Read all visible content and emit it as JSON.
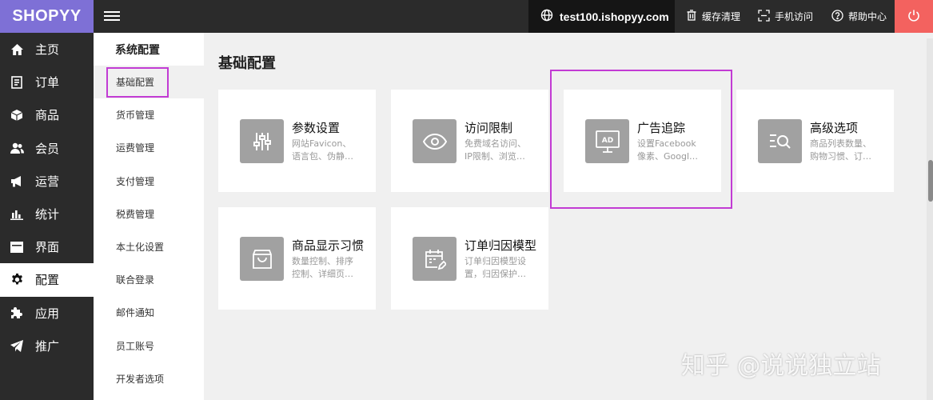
{
  "header": {
    "logo": "SHOPYY",
    "domain": "test100.ishopyy.com",
    "links": [
      {
        "label": "缓存清理",
        "icon": "trash-icon"
      },
      {
        "label": "手机访问",
        "icon": "mobile-icon"
      },
      {
        "label": "帮助中心",
        "icon": "help-icon"
      }
    ],
    "accent_color": "#7e70d6",
    "power_color": "#f3625f"
  },
  "nav": {
    "items": [
      {
        "label": "主页",
        "icon": "home-icon"
      },
      {
        "label": "订单",
        "icon": "order-icon"
      },
      {
        "label": "商品",
        "icon": "box-icon"
      },
      {
        "label": "会员",
        "icon": "users-icon"
      },
      {
        "label": "运营",
        "icon": "megaphone-icon"
      },
      {
        "label": "统计",
        "icon": "bar-chart-icon"
      },
      {
        "label": "界面",
        "icon": "layout-icon"
      },
      {
        "label": "配置",
        "icon": "gear-icon"
      },
      {
        "label": "应用",
        "icon": "puzzle-icon"
      },
      {
        "label": "推广",
        "icon": "send-icon"
      }
    ],
    "active": "配置"
  },
  "subnav": {
    "title": "系统配置",
    "items": [
      "基础配置",
      "货币管理",
      "运费管理",
      "支付管理",
      "税费管理",
      "本土化设置",
      "联合登录",
      "邮件通知",
      "员工账号",
      "开发者选项"
    ],
    "active": "基础配置"
  },
  "main": {
    "title": "基础配置",
    "cards": [
      {
        "title": "参数设置",
        "desc": [
          "网站Favicon、",
          "语言包、伪静…"
        ],
        "icon": "sliders-icon"
      },
      {
        "title": "访问限制",
        "desc": [
          "免费域名访问、",
          "IP限制、浏览…"
        ],
        "icon": "eye-icon"
      },
      {
        "title": "广告追踪",
        "desc": [
          "设置Facebook",
          "像素、Googl…"
        ],
        "icon": "ad-icon"
      },
      {
        "title": "高级选项",
        "desc": [
          "商品列表数量、",
          "购物习惯、订…"
        ],
        "icon": "search-list-icon"
      },
      {
        "title": "商品显示习惯",
        "desc": [
          "数量控制、排序",
          "控制、详细页…"
        ],
        "icon": "bag-icon"
      },
      {
        "title": "订单归因模型",
        "desc": [
          "订单归因模型设",
          "置，归因保护…"
        ],
        "icon": "calendar-edit-icon"
      }
    ]
  },
  "watermark": "知乎 @说说独立站"
}
